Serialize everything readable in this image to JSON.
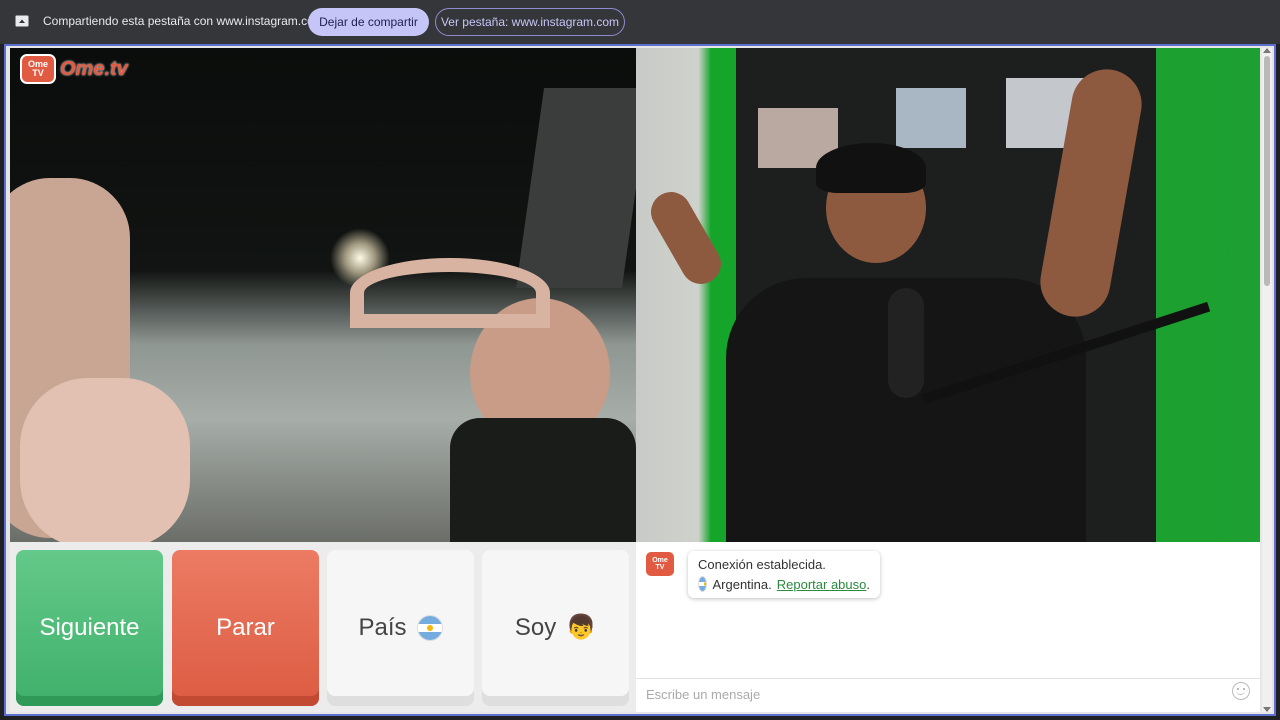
{
  "sharebar": {
    "message": "Compartiendo esta pestaña con www.instagram.com",
    "stop_label": "Dejar de compartir",
    "view_label": "Ver pestaña: www.instagram.com"
  },
  "app": {
    "logo_badge_top": "Ome",
    "logo_badge_bottom": "TV",
    "logo_text": "Ome.tv",
    "brand_color": "#e15b43"
  },
  "controls": {
    "next_label": "Siguiente",
    "stop_label": "Parar",
    "country_label": "País",
    "gender_label": "Soy",
    "country_flag": "argentina-flag",
    "gender_icon": "boy-icon",
    "next_color": "#4cbb78",
    "stop_color": "#e4664d"
  },
  "chat": {
    "status": "Conexión establecida.",
    "country": "Argentina.",
    "report_link": "Reportar abuso",
    "report_suffix": ".",
    "input_placeholder": "Escribe un mensaje"
  }
}
